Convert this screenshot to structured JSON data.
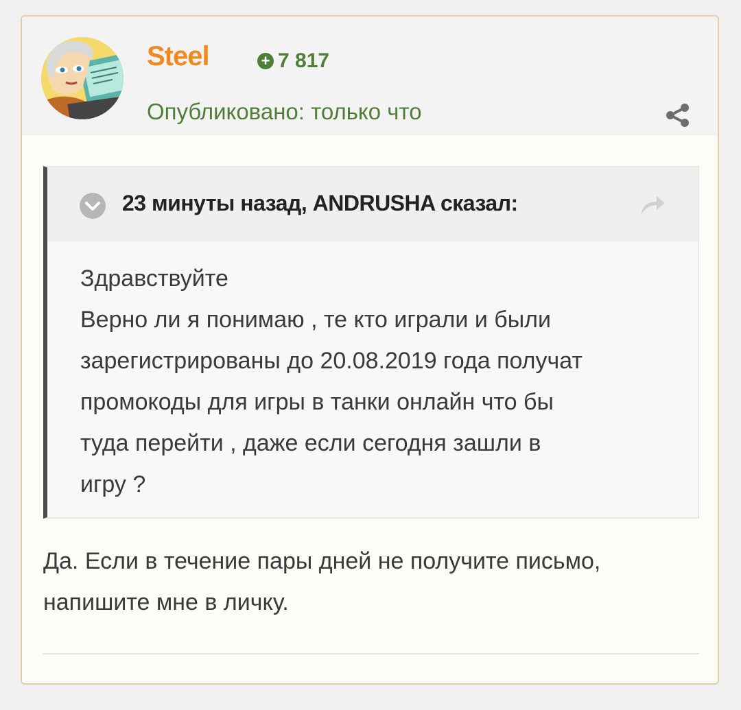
{
  "post": {
    "author": {
      "name": "Steel",
      "reputation": "7 817",
      "reputation_icon": "plus-circle-icon",
      "avatar": "avatar-illustration"
    },
    "published": "Опубликовано: только что",
    "share_icon": "share-icon",
    "quote": {
      "citation": "23 минуты назад, ANDRUSHA сказал:",
      "toggle_icon": "chevron-down-circle-icon",
      "forward_icon": "forward-arrow-icon",
      "lines": [
        "Здравствуйте",
        "Верно ли я понимаю , те кто играли и были",
        "зарегистрированы до 20.08.2019 года получат",
        "промокоды для игры в танки онлайн что бы",
        "туда перейти , даже если сегодня зашли в",
        "игру ?"
      ]
    },
    "reply": {
      "lines": [
        "Да. Если в течение пары дней не получите письмо,",
        "напишите мне в личку."
      ]
    }
  },
  "colors": {
    "author": "#f08a1e",
    "reputation": "#4f7f36",
    "published": "#4f7f36",
    "post_border": "#e2cfa6",
    "quote_bar": "#4d4d4d"
  }
}
